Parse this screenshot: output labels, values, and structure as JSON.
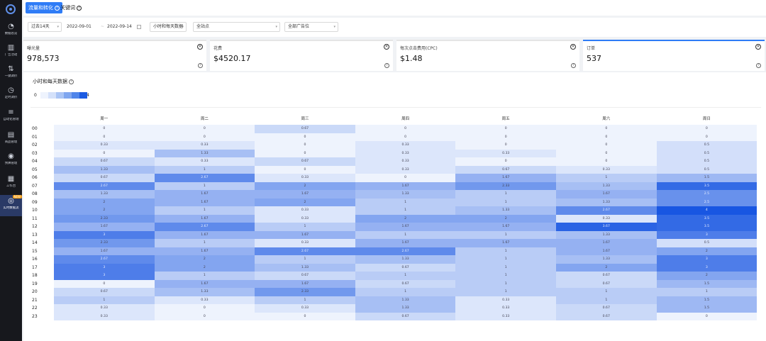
{
  "sidebar": {
    "logo": "app-logo",
    "items": [
      {
        "label": "数据总览",
        "icon": "pie-icon"
      },
      {
        "label": "广告活动",
        "icon": "chart-icon"
      },
      {
        "label": "一键调价",
        "icon": "adjust-icon"
      },
      {
        "label": "定时调价",
        "icon": "clock-icon"
      },
      {
        "label": "自动化管理",
        "icon": "sliders-icon"
      },
      {
        "label": "商品管理",
        "icon": "document-icon"
      },
      {
        "label": "预算管理",
        "icon": "target-icon"
      },
      {
        "label": "工作台",
        "icon": "grid-icon"
      },
      {
        "label": "实时数据流",
        "icon": "stream-icon",
        "active": true,
        "badge": "NEW"
      }
    ]
  },
  "tabs": [
    {
      "label": "流量和转化",
      "active": true
    },
    {
      "label": "关键词",
      "active": false
    }
  ],
  "filters": {
    "range": "过去14天",
    "date_start": "2022-09-01",
    "date_sep": "~",
    "date_end": "2022-09-14",
    "granularity": "小时和每天数据",
    "site": "全站点",
    "placement": "全部广告位"
  },
  "cards": [
    {
      "title": "曝光量",
      "value": "978,573"
    },
    {
      "title": "花费",
      "value": "$4520.17"
    },
    {
      "title": "每次点击费用(CPC)",
      "value": "$1.48"
    },
    {
      "title": "订单",
      "value": "537"
    }
  ],
  "panel": {
    "title": "小时和每天数据",
    "legend_min": "0",
    "legend_max": "4",
    "legend_colors": [
      "#eef3fd",
      "#d4e1fa",
      "#a9c4f5",
      "#7fa6ef",
      "#4f85ea",
      "#1b5be2"
    ]
  },
  "heatmap": {
    "days": [
      "周一",
      "周二",
      "周三",
      "周四",
      "周五",
      "周六",
      "周日"
    ],
    "hours": [
      "00",
      "01",
      "02",
      "03",
      "04",
      "05",
      "06",
      "07",
      "08",
      "09",
      "10",
      "11",
      "12",
      "13",
      "14",
      "15",
      "16",
      "17",
      "18",
      "19",
      "20",
      "21",
      "22",
      "23"
    ],
    "max": 4,
    "values": [
      [
        "0",
        "0",
        "0.67",
        "0",
        "0",
        "0",
        "0"
      ],
      [
        "0",
        "0",
        "0",
        "0",
        "0",
        "0",
        "0"
      ],
      [
        "0.33",
        "0.33",
        "0",
        "0.33",
        "0",
        "0",
        "0.5"
      ],
      [
        "0",
        "1.33",
        "0",
        "0.33",
        "0.33",
        "0",
        "0.5"
      ],
      [
        "0.67",
        "0.33",
        "0.67",
        "0.33",
        "0",
        "0",
        "0.5"
      ],
      [
        "1.33",
        "1",
        "0",
        "0.33",
        "0.67",
        "0.33",
        "0.5"
      ],
      [
        "0.67",
        "2.67",
        "0.33",
        "0",
        "1.67",
        "1",
        "1.5"
      ],
      [
        "2.67",
        "1",
        "2",
        "1.67",
        "2.33",
        "1.33",
        "3.5"
      ],
      [
        "1.33",
        "1.67",
        "1.67",
        "1.33",
        "1",
        "1.67",
        "2.5"
      ],
      [
        "2",
        "1.67",
        "2",
        "1",
        "1",
        "1.33",
        "2.5"
      ],
      [
        "2",
        "1",
        "0.33",
        "1",
        "1.33",
        "2.67",
        "4"
      ],
      [
        "2.33",
        "1.67",
        "0.33",
        "2",
        "2",
        "0.33",
        "3.5"
      ],
      [
        "1.67",
        "2.67",
        "1",
        "1.67",
        "1.67",
        "3.67",
        "3.5"
      ],
      [
        "3",
        "1.67",
        "1.67",
        "1",
        "1",
        "1.33",
        "3"
      ],
      [
        "2.33",
        "1",
        "0.33",
        "1.67",
        "1.67",
        "1.67",
        "0.5"
      ],
      [
        "1.67",
        "1.67",
        "2.67",
        "2.67",
        "1",
        "1.67",
        "2"
      ],
      [
        "2.67",
        "2",
        "1",
        "1.33",
        "1",
        "1.33",
        "3"
      ],
      [
        "3",
        "2",
        "1.33",
        "0.67",
        "1",
        "2",
        "3"
      ],
      [
        "3",
        "1",
        "0.67",
        "1",
        "1",
        "0.67",
        "2"
      ],
      [
        "0",
        "1.67",
        "1.67",
        "0.67",
        "1",
        "0.67",
        "1.5"
      ],
      [
        "0.67",
        "1.33",
        "2.33",
        "1",
        "1",
        "1",
        "1"
      ],
      [
        "1",
        "0.33",
        "1",
        "1.33",
        "0.33",
        "1",
        "1.5"
      ],
      [
        "0.33",
        "0",
        "0.33",
        "1.33",
        "0.33",
        "0.67",
        "1.5"
      ],
      [
        "0.33",
        "0",
        "0",
        "0.67",
        "0.33",
        "0.67",
        "0"
      ]
    ]
  }
}
